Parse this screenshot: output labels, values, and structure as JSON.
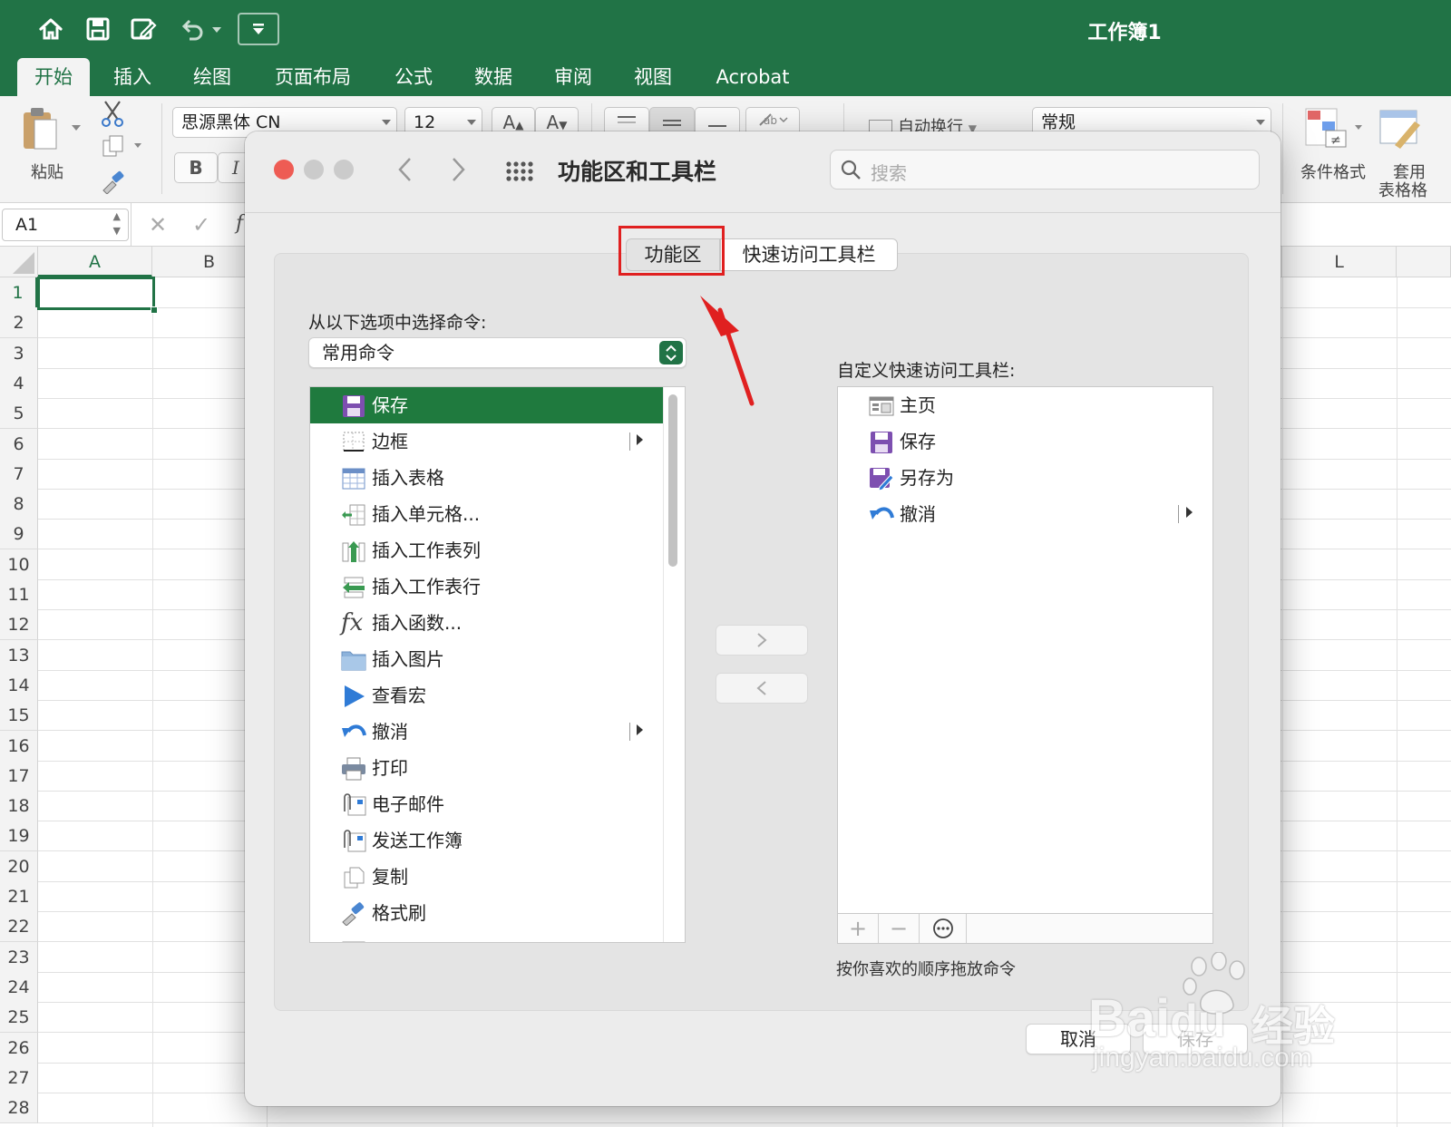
{
  "excel": {
    "title": "工作簿1",
    "tabs": [
      "开始",
      "插入",
      "绘图",
      "页面布局",
      "公式",
      "数据",
      "审阅",
      "视图",
      "Acrobat"
    ],
    "active_tab": "开始",
    "ribbon": {
      "paste_label": "粘贴",
      "font_name": "思源黑体 CN",
      "font_size": "12",
      "bold": "B",
      "italic": "I",
      "grow_font": "A",
      "shrink_font": "A",
      "wrap_text": "自动换行",
      "number_format": "常规",
      "conditional_format": "条件格式",
      "table_format_line1": "套用",
      "table_format_line2": "表格格"
    },
    "name_box": "A1",
    "formula_prefix": "f",
    "columns": [
      "A",
      "B",
      "L"
    ],
    "rows": [
      "1",
      "2",
      "3",
      "4",
      "5",
      "6",
      "7",
      "8",
      "9",
      "10",
      "11",
      "12",
      "13",
      "14",
      "15",
      "16",
      "17",
      "18",
      "19",
      "20",
      "21",
      "22",
      "23",
      "24",
      "25",
      "26",
      "27",
      "28"
    ]
  },
  "dialog": {
    "title": "功能区和工具栏",
    "search_placeholder": "搜索",
    "segments": [
      "功能区",
      "快速访问工具栏"
    ],
    "choose_label": "从以下选项中选择命令:",
    "choose_value": "常用命令",
    "left_items": [
      {
        "label": "保存",
        "icon": "save-icon"
      },
      {
        "label": "边框",
        "icon": "border-icon"
      },
      {
        "label": "插入表格",
        "icon": "insert-table-icon"
      },
      {
        "label": "插入单元格...",
        "icon": "insert-cells-icon"
      },
      {
        "label": "插入工作表列",
        "icon": "insert-column-icon"
      },
      {
        "label": "插入工作表行",
        "icon": "insert-row-icon"
      },
      {
        "label": "插入函数...",
        "icon": "function-icon"
      },
      {
        "label": "插入图片",
        "icon": "folder-icon"
      },
      {
        "label": "查看宏",
        "icon": "play-icon"
      },
      {
        "label": "撤消",
        "icon": "undo-icon"
      },
      {
        "label": "打印",
        "icon": "printer-icon"
      },
      {
        "label": "电子邮件",
        "icon": "email-icon"
      },
      {
        "label": "发送工作簿",
        "icon": "send-workbook-icon"
      },
      {
        "label": "复制",
        "icon": "copy-icon"
      },
      {
        "label": "格式刷",
        "icon": "format-painter-icon"
      }
    ],
    "customize_label": "自定义快速访问工具栏:",
    "right_items": [
      {
        "label": "主页",
        "icon": "home-page-icon"
      },
      {
        "label": "保存",
        "icon": "save-icon"
      },
      {
        "label": "另存为",
        "icon": "save-as-icon"
      },
      {
        "label": "撤消",
        "icon": "undo-icon"
      }
    ],
    "add_symbol": "+",
    "remove_symbol": "−",
    "hint": "按你喜欢的顺序拖放命令",
    "cancel": "取消",
    "save": "保存"
  },
  "watermark": {
    "brand": "Bai",
    "brand_tail": "du",
    "cn": "经验",
    "url": "jingyan.baidu.com"
  },
  "colors": {
    "excel_green": "#217346",
    "selection_green": "#1f7a3e",
    "annotation_red": "#e02020"
  }
}
